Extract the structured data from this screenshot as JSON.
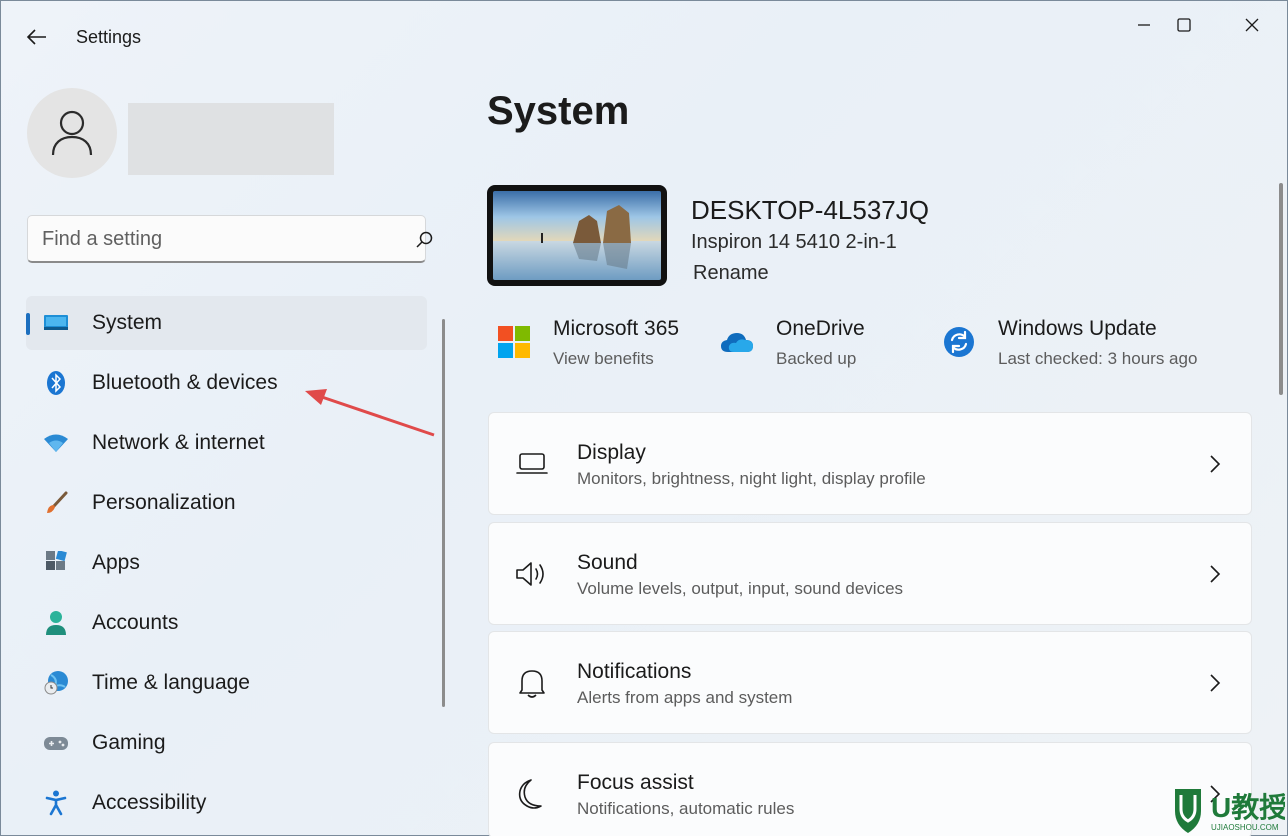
{
  "window": {
    "title": "Settings"
  },
  "search": {
    "placeholder": "Find a setting"
  },
  "nav": {
    "items": [
      {
        "label": "System",
        "icon": "monitor-icon",
        "active": true
      },
      {
        "label": "Bluetooth & devices",
        "icon": "bluetooth-icon"
      },
      {
        "label": "Network & internet",
        "icon": "wifi-icon"
      },
      {
        "label": "Personalization",
        "icon": "brush-icon"
      },
      {
        "label": "Apps",
        "icon": "apps-icon"
      },
      {
        "label": "Accounts",
        "icon": "person-icon"
      },
      {
        "label": "Time & language",
        "icon": "globe-clock-icon"
      },
      {
        "label": "Gaming",
        "icon": "gamepad-icon"
      },
      {
        "label": "Accessibility",
        "icon": "accessibility-icon"
      }
    ]
  },
  "main": {
    "title": "System",
    "device": {
      "name": "DESKTOP-4L537JQ",
      "model": "Inspiron 14 5410 2-in-1",
      "rename": "Rename"
    },
    "quick": [
      {
        "title": "Microsoft 365",
        "sub": "View benefits",
        "icon": "microsoft-logo-icon"
      },
      {
        "title": "OneDrive",
        "sub": "Backed up",
        "icon": "onedrive-cloud-icon"
      },
      {
        "title": "Windows Update",
        "sub": "Last checked: 3 hours ago",
        "icon": "windows-update-icon"
      }
    ],
    "cards": [
      {
        "title": "Display",
        "sub": "Monitors, brightness, night light, display profile",
        "icon": "laptop-icon"
      },
      {
        "title": "Sound",
        "sub": "Volume levels, output, input, sound devices",
        "icon": "speaker-icon"
      },
      {
        "title": "Notifications",
        "sub": "Alerts from apps and system",
        "icon": "bell-icon"
      },
      {
        "title": "Focus assist",
        "sub": "Notifications, automatic rules",
        "icon": "moon-icon"
      }
    ]
  },
  "watermark": {
    "text": "U教授",
    "url": "UJIAOSHOU.COM"
  },
  "colors": {
    "accent": "#1c6fbf",
    "background": "#eef3f9",
    "card": "#fbfcfd",
    "annotation_arrow": "#e04a4a"
  }
}
